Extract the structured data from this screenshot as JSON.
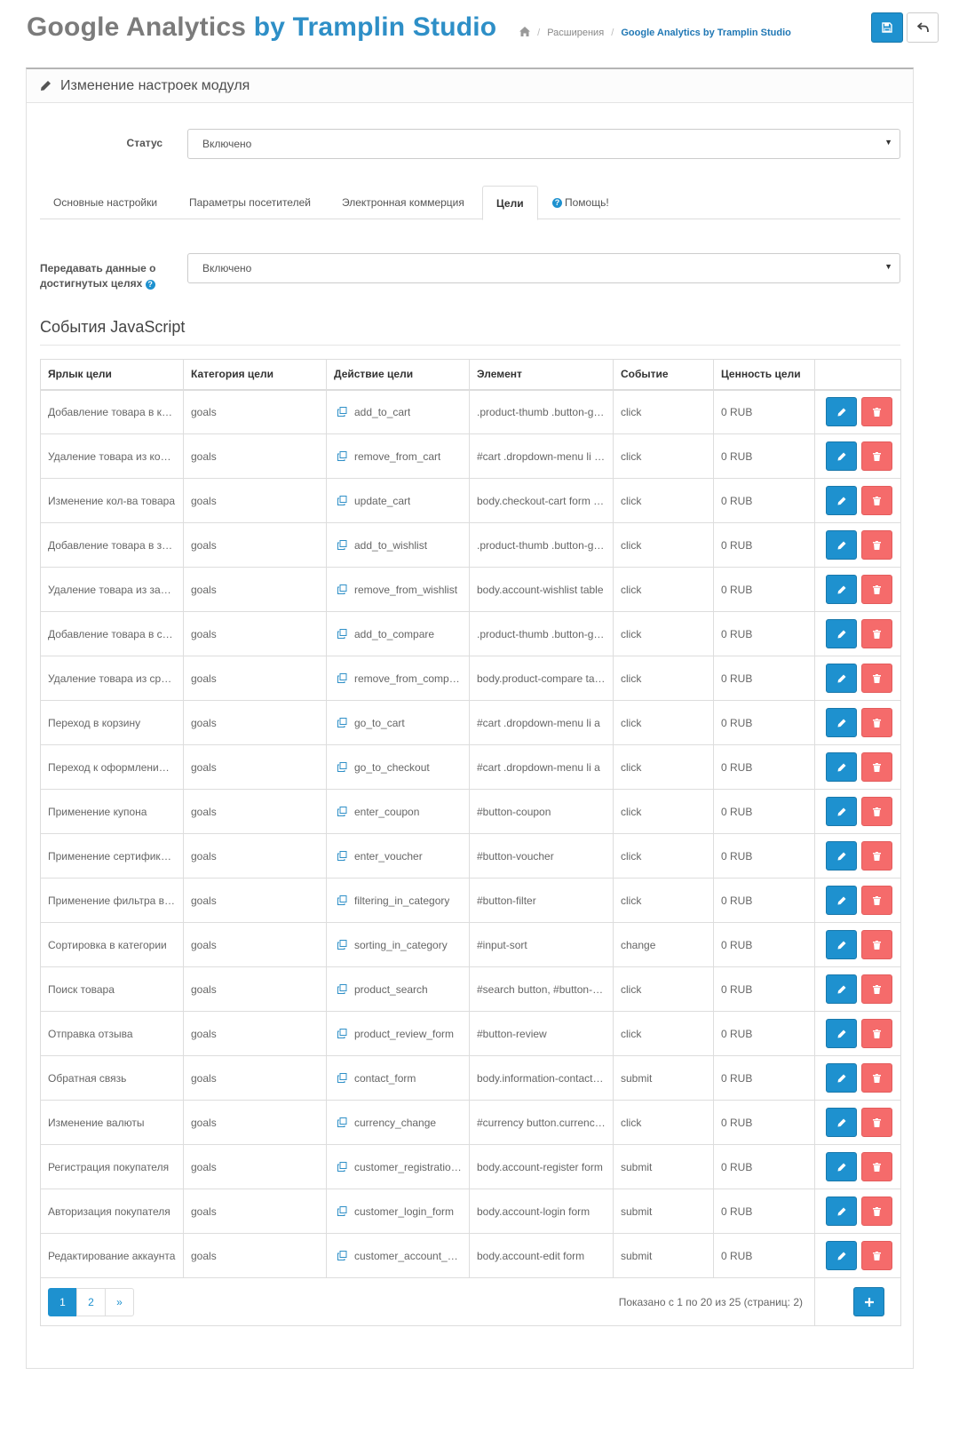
{
  "header": {
    "title_main": "Google Analytics",
    "title_brand": "by Tramplin Studio",
    "breadcrumb": [
      {
        "label": "Расширения"
      },
      {
        "label": "Google Analytics by Tramplin Studio"
      }
    ],
    "save_icon": "save-icon",
    "back_icon": "reply-icon"
  },
  "panel": {
    "heading": "Изменение настроек модуля",
    "heading_icon": "pencil-icon"
  },
  "status": {
    "label": "Статус",
    "value": "Включено"
  },
  "tabs": [
    {
      "label": "Основные настройки",
      "active": false
    },
    {
      "label": "Параметры посетителей",
      "active": false
    },
    {
      "label": "Электронная коммерция",
      "active": false
    },
    {
      "label": "Цели",
      "active": true
    },
    {
      "label": "Помощь!",
      "active": false
    }
  ],
  "goals_toggle": {
    "label_line1": "Передавать данные о",
    "label_line2": "достигнутых целях",
    "value": "Включено"
  },
  "section_title": "События JavaScript",
  "table": {
    "columns": [
      "Ярлык цели",
      "Категория цели",
      "Действие цели",
      "Элемент",
      "Событие",
      "Ценность цели",
      ""
    ],
    "rows": [
      {
        "label": "Добавление товара в корзину",
        "category": "goals",
        "action": "add_to_cart",
        "element": ".product-thumb .button-group",
        "event": "click",
        "value": "0 RUB"
      },
      {
        "label": "Удаление товара из корзины",
        "category": "goals",
        "action": "remove_from_cart",
        "element": "#cart .dropdown-menu li button",
        "event": "click",
        "value": "0 RUB"
      },
      {
        "label": "Изменение кол-ва товара",
        "category": "goals",
        "action": "update_cart",
        "element": "body.checkout-cart form button",
        "event": "click",
        "value": "0 RUB"
      },
      {
        "label": "Добавление товара в закладки",
        "category": "goals",
        "action": "add_to_wishlist",
        "element": ".product-thumb .button-group",
        "event": "click",
        "value": "0 RUB"
      },
      {
        "label": "Удаление товара из закладок",
        "category": "goals",
        "action": "remove_from_wishlist",
        "element": "body.account-wishlist table",
        "event": "click",
        "value": "0 RUB"
      },
      {
        "label": "Добавление товара в сравнение",
        "category": "goals",
        "action": "add_to_compare",
        "element": ".product-thumb .button-group",
        "event": "click",
        "value": "0 RUB"
      },
      {
        "label": "Удаление товара из сравнения",
        "category": "goals",
        "action": "remove_from_compare",
        "element": "body.product-compare table",
        "event": "click",
        "value": "0 RUB"
      },
      {
        "label": "Переход в корзину",
        "category": "goals",
        "action": "go_to_cart",
        "element": "#cart .dropdown-menu li a",
        "event": "click",
        "value": "0 RUB"
      },
      {
        "label": "Переход к оформлению заказа",
        "category": "goals",
        "action": "go_to_checkout",
        "element": "#cart .dropdown-menu li a",
        "event": "click",
        "value": "0 RUB"
      },
      {
        "label": "Применение купона",
        "category": "goals",
        "action": "enter_coupon",
        "element": "#button-coupon",
        "event": "click",
        "value": "0 RUB"
      },
      {
        "label": "Применение сертификата",
        "category": "goals",
        "action": "enter_voucher",
        "element": "#button-voucher",
        "event": "click",
        "value": "0 RUB"
      },
      {
        "label": "Применение фильтра в категории",
        "category": "goals",
        "action": "filtering_in_category",
        "element": "#button-filter",
        "event": "click",
        "value": "0 RUB"
      },
      {
        "label": "Сортировка в категории",
        "category": "goals",
        "action": "sorting_in_category",
        "element": "#input-sort",
        "event": "change",
        "value": "0 RUB"
      },
      {
        "label": "Поиск товара",
        "category": "goals",
        "action": "product_search",
        "element": "#search button, #button-search",
        "event": "click",
        "value": "0 RUB"
      },
      {
        "label": "Отправка отзыва",
        "category": "goals",
        "action": "product_review_form",
        "element": "#button-review",
        "event": "click",
        "value": "0 RUB"
      },
      {
        "label": "Обратная связь",
        "category": "goals",
        "action": "contact_form",
        "element": "body.information-contact form",
        "event": "submit",
        "value": "0 RUB"
      },
      {
        "label": "Изменение валюты",
        "category": "goals",
        "action": "currency_change",
        "element": "#currency button.currency-select",
        "event": "click",
        "value": "0 RUB"
      },
      {
        "label": "Регистрация покупателя",
        "category": "goals",
        "action": "customer_registration_form",
        "element": "body.account-register form",
        "event": "submit",
        "value": "0 RUB"
      },
      {
        "label": "Авторизация покупателя",
        "category": "goals",
        "action": "customer_login_form",
        "element": "body.account-login form",
        "event": "submit",
        "value": "0 RUB"
      },
      {
        "label": "Редактирование аккаунта",
        "category": "goals",
        "action": "customer_account_edit_form",
        "element": "body.account-edit form",
        "event": "submit",
        "value": "0 RUB"
      }
    ]
  },
  "pagination": {
    "pages": [
      "1",
      "2",
      "»"
    ],
    "active": "1",
    "info": "Показано с 1 по 20 из 25 (страниц: 2)"
  },
  "colors": {
    "primary": "#1e91cf",
    "danger": "#f56b6b",
    "title_gray": "#7b7b7b",
    "brand_blue": "#2e8fc7"
  }
}
